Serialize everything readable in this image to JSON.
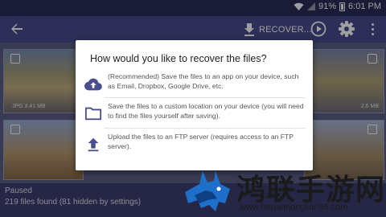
{
  "status_bar": {
    "battery": "91%",
    "time": "6:01 PM",
    "icons": [
      "wifi-icon",
      "signal-icon",
      "battery-icon"
    ]
  },
  "app_bar": {
    "back_icon": "arrow-back-icon",
    "recover_label": "RECOVER...",
    "recover_icon": "download-icon",
    "play_icon": "play-circle-icon",
    "settings_icon": "gear-icon",
    "more_icon": "more-vert-icon"
  },
  "gallery": {
    "thumbnails": [
      {
        "caption": "JPG 3.41 MB"
      },
      {
        "caption": ""
      },
      {
        "caption": "2.6 MB"
      },
      {
        "caption": ""
      }
    ],
    "status_paused": "Paused",
    "status_found": "219 files found (81 hidden by settings)"
  },
  "dialog": {
    "title": "How would you like to recover the files?",
    "options": [
      {
        "icon": "cloud-upload-icon",
        "text": "(Recommended) Save the files to an app on your device, such as Email, Dropbox, Google Drive, etc."
      },
      {
        "icon": "folder-icon",
        "text": "Save the files to a custom location on your device (you will need to find the files yourself after saving)."
      },
      {
        "icon": "upload-icon",
        "text": "Upload the files to an FTP server (requires access to an FTP server)."
      }
    ]
  },
  "watermark": {
    "title": "鸿联手游网",
    "url": "www.henanhonglian95.com"
  },
  "colors": {
    "status_bar": "#2b2d58",
    "app_bar": "#4a4d8e",
    "dialog_icon": "#4a4d8e",
    "dialog_bg": "#ffffff"
  }
}
